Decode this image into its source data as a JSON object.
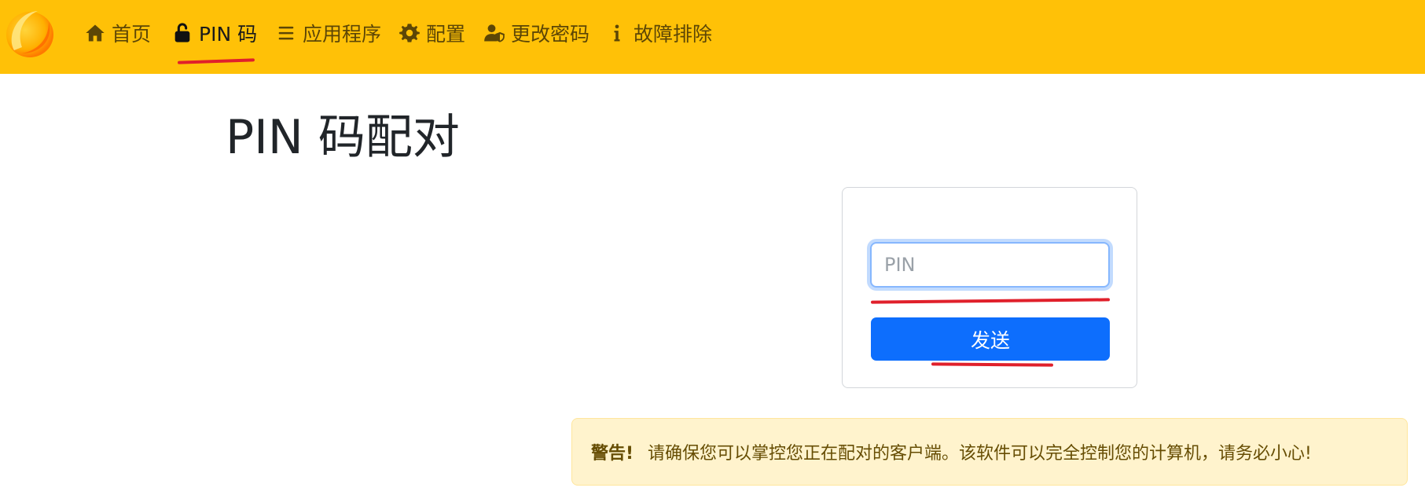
{
  "navbar": {
    "bg_color": "#ffc107",
    "logo": "sunshine-logo",
    "items": [
      {
        "label": "首页",
        "icon": "home-icon",
        "active": false
      },
      {
        "label": "PIN 码",
        "icon": "unlock-icon",
        "active": true
      },
      {
        "label": "应用程序",
        "icon": "list-icon",
        "active": false
      },
      {
        "label": "配置",
        "icon": "gear-icon",
        "active": false
      },
      {
        "label": "更改密码",
        "icon": "user-shield-icon",
        "active": false
      },
      {
        "label": "故障排除",
        "icon": "info-icon",
        "active": false
      }
    ]
  },
  "main": {
    "title": "PIN 码配对",
    "form": {
      "pin_placeholder": "PIN",
      "pin_value": "",
      "send_label": "发送"
    },
    "alert": {
      "strong": "警告!",
      "message": "请确保您可以掌控您正在配对的客户端。该软件可以完全控制您的计算机，请务必小心!",
      "bg_color": "#fff3cd",
      "text_color": "#664d03"
    }
  },
  "colors": {
    "accent": "#0d6efd",
    "annotation": "#e0202b"
  }
}
